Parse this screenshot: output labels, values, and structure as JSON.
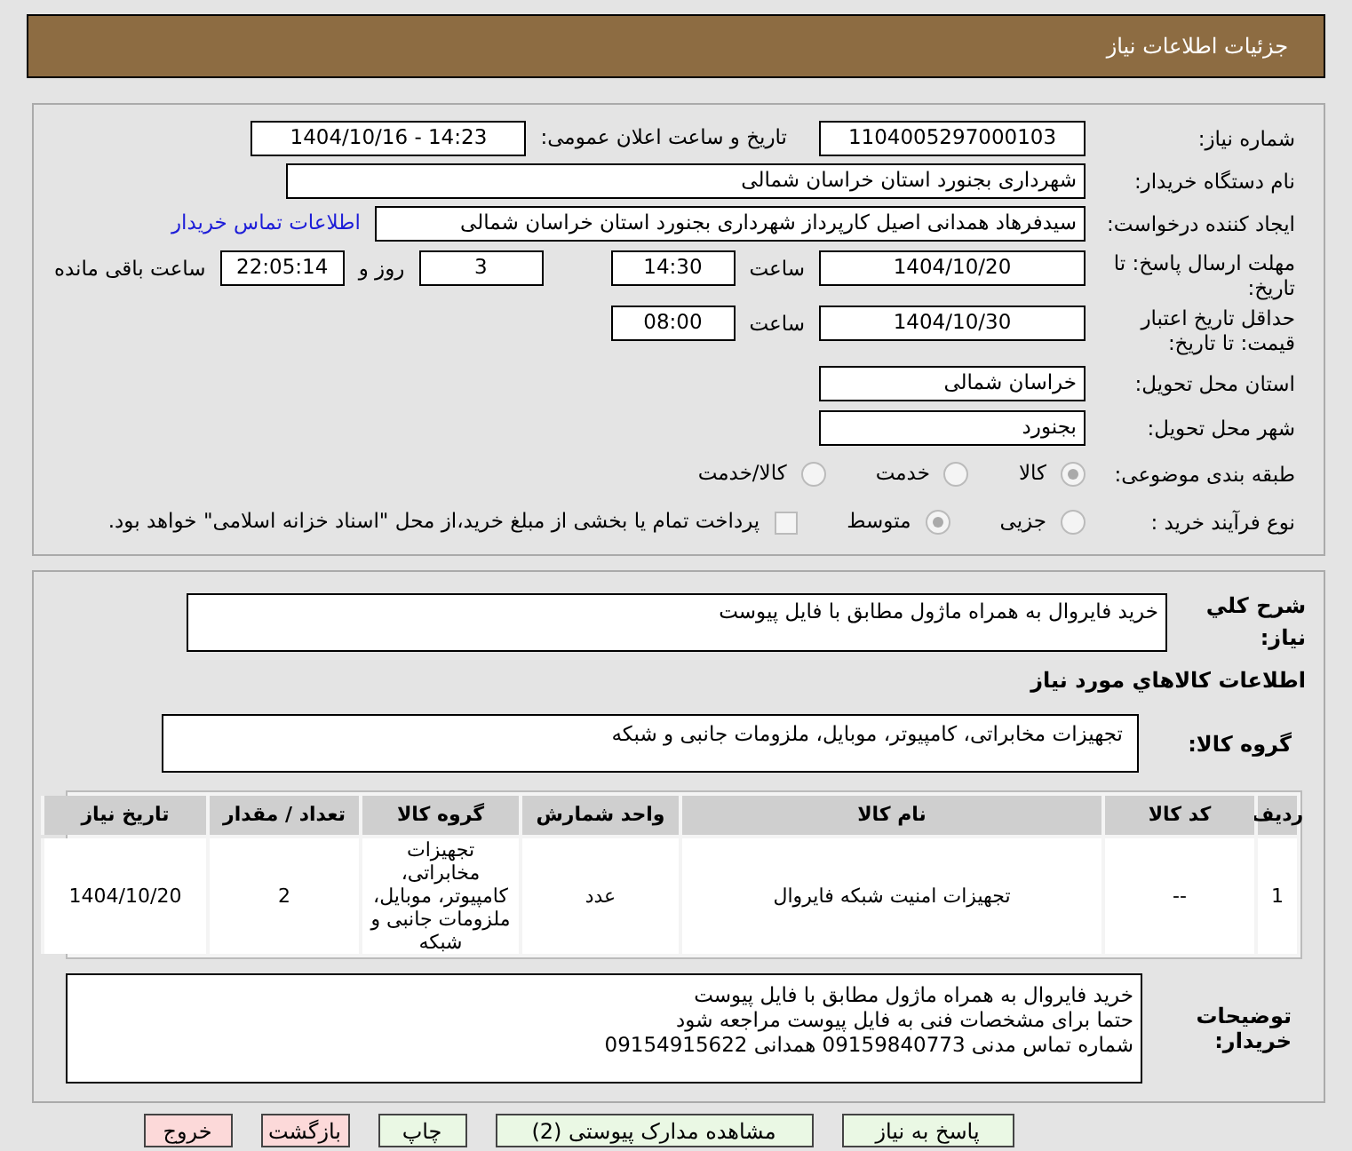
{
  "header": {
    "title": "جزئیات اطلاعات نیاز"
  },
  "need_number": {
    "label": "شماره نیاز:",
    "value": "1104005297000103"
  },
  "announce": {
    "label": "تاریخ و ساعت اعلان عمومی:",
    "value": "1404/10/16 - 14:23"
  },
  "buyer": {
    "label": "نام دستگاه خریدار:",
    "value": "شهرداری بجنورد استان خراسان شمالی"
  },
  "requester": {
    "label": "ایجاد کننده درخواست:",
    "value": "سیدفرهاد همدانی اصیل کارپرداز شهرداری بجنورد استان خراسان شمالی",
    "link": "اطلاعات تماس خریدار"
  },
  "reply_deadline": {
    "label": "مهلت ارسال پاسخ: تا تاریخ:",
    "date": "1404/10/20",
    "time_label": "ساعت",
    "time": "14:30",
    "days": "3",
    "days_label": "روز و",
    "remaining": "22:05:14",
    "remaining_label": "ساعت باقی مانده"
  },
  "price_validity": {
    "label": "حداقل تاریخ اعتبار قیمت: تا تاریخ:",
    "date": "1404/10/30",
    "time_label": "ساعت",
    "time": "08:00"
  },
  "province": {
    "label": "استان محل تحویل:",
    "value": "خراسان شمالی"
  },
  "city": {
    "label": "شهر محل تحویل:",
    "value": "بجنورد"
  },
  "category": {
    "label": "طبقه بندی موضوعی:",
    "options": [
      {
        "label": "کالا",
        "selected": true
      },
      {
        "label": "خدمت",
        "selected": false
      },
      {
        "label": "کالا/خدمت",
        "selected": false
      }
    ]
  },
  "process": {
    "label": "نوع فرآیند خرید :",
    "options": [
      {
        "label": "جزیی",
        "selected": false
      },
      {
        "label": "متوسط",
        "selected": true
      }
    ],
    "treasury": {
      "checked": false,
      "label": "پرداخت تمام یا بخشی از مبلغ خرید،از محل \"اسناد خزانه اسلامی\" خواهد بود."
    }
  },
  "description": {
    "label": "شرح کلي نياز:",
    "value": "خرید فایروال به همراه ماژول مطابق با فایل پیوست"
  },
  "goods_title": "اطلاعات کالاهاي مورد نياز",
  "goods_group": {
    "label": "گروه کالا:",
    "value": "تجهیزات مخابراتی، کامپیوتر، موبایل، ملزومات جانبی و شبکه"
  },
  "table": {
    "columns": [
      "ردیف",
      "کد کالا",
      "نام کالا",
      "واحد شمارش",
      "گروه کالا",
      "تعداد / مقدار",
      "تاریخ نیاز"
    ],
    "rows": [
      [
        "1",
        "--",
        "تجهیزات امنیت شبکه فایروال",
        "عدد",
        "تجهیزات مخابراتی، کامپیوتر، موبایل، ملزومات جانبی و شبکه",
        "2",
        "1404/10/20"
      ]
    ]
  },
  "buyer_notes": {
    "label": "توضیحات خریدار:",
    "lines": [
      "خرید فایروال به همراه ماژول مطابق با فایل پیوست",
      "حتما برای مشخصات فنی به فایل پیوست مراجعه شود",
      "شماره تماس مدنی 09159840773 همدانی 09154915622"
    ]
  },
  "buttons": [
    {
      "label": "پاسخ به نیاز",
      "kind": "green"
    },
    {
      "label": "مشاهده مدارک پیوستی (2)",
      "kind": "green"
    },
    {
      "label": "چاپ",
      "kind": "green"
    },
    {
      "label": "بازگشت",
      "kind": "red"
    },
    {
      "label": "خروج",
      "kind": "red"
    }
  ]
}
